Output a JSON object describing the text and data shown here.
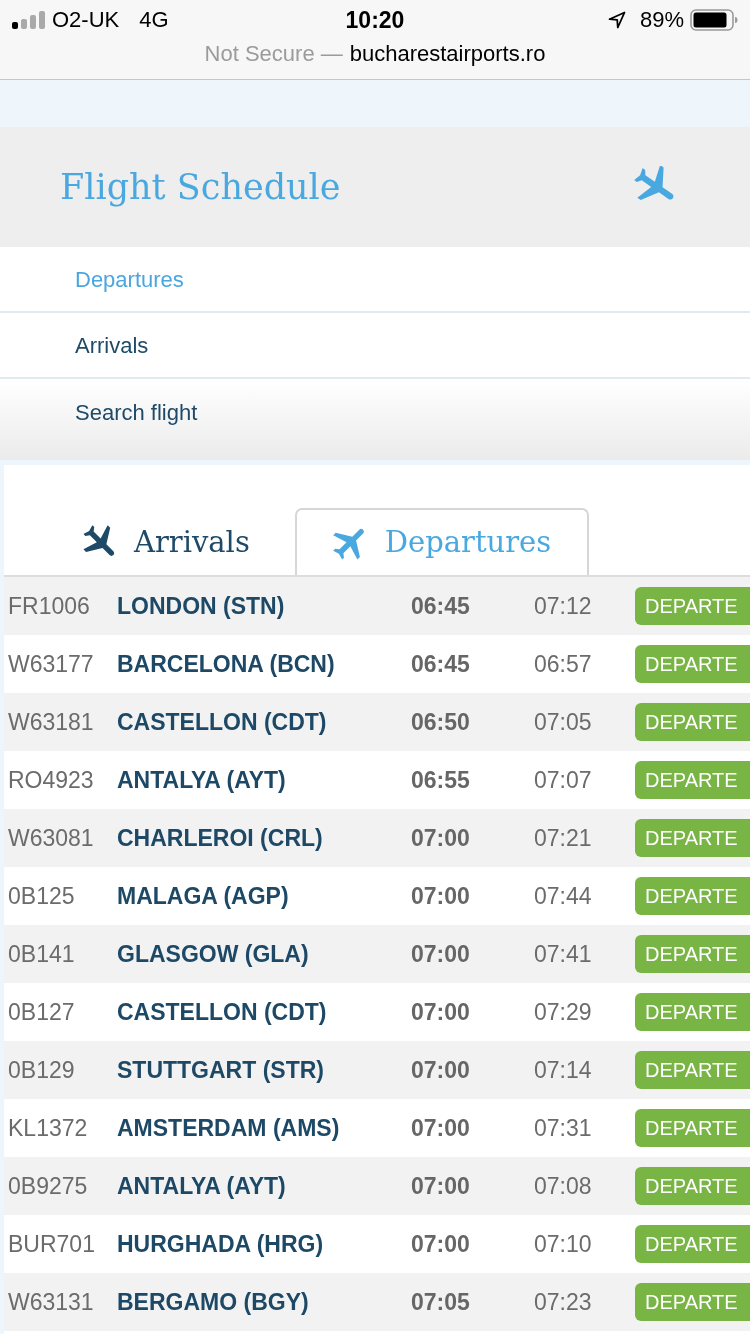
{
  "status_bar": {
    "carrier": "O2-UK",
    "network": "4G",
    "time": "10:20",
    "battery": "89%"
  },
  "address_bar": {
    "security": "Not Secure —",
    "domain": "bucharestairports.ro"
  },
  "header": {
    "title": "Flight Schedule"
  },
  "menu": [
    {
      "label": "Departures",
      "selected": true
    },
    {
      "label": "Arrivals",
      "selected": false
    },
    {
      "label": "Search flight",
      "selected": false
    }
  ],
  "tabs": [
    {
      "label": "Arrivals",
      "selected": false
    },
    {
      "label": "Departures",
      "selected": true
    }
  ],
  "flights": [
    {
      "flight": "FR1006",
      "destination": "LONDON (STN)",
      "scheduled": "06:45",
      "actual": "07:12",
      "status": "DEPARTE"
    },
    {
      "flight": "W63177",
      "destination": "BARCELONA (BCN)",
      "scheduled": "06:45",
      "actual": "06:57",
      "status": "DEPARTE"
    },
    {
      "flight": "W63181",
      "destination": "CASTELLON (CDT)",
      "scheduled": "06:50",
      "actual": "07:05",
      "status": "DEPARTE"
    },
    {
      "flight": "RO4923",
      "destination": "ANTALYA (AYT)",
      "scheduled": "06:55",
      "actual": "07:07",
      "status": "DEPARTE"
    },
    {
      "flight": "W63081",
      "destination": "CHARLEROI (CRL)",
      "scheduled": "07:00",
      "actual": "07:21",
      "status": "DEPARTE"
    },
    {
      "flight": "0B125",
      "destination": "MALAGA (AGP)",
      "scheduled": "07:00",
      "actual": "07:44",
      "status": "DEPARTE"
    },
    {
      "flight": "0B141",
      "destination": "GLASGOW (GLA)",
      "scheduled": "07:00",
      "actual": "07:41",
      "status": "DEPARTE"
    },
    {
      "flight": "0B127",
      "destination": "CASTELLON (CDT)",
      "scheduled": "07:00",
      "actual": "07:29",
      "status": "DEPARTE"
    },
    {
      "flight": "0B129",
      "destination": "STUTTGART (STR)",
      "scheduled": "07:00",
      "actual": "07:14",
      "status": "DEPARTE"
    },
    {
      "flight": "KL1372",
      "destination": "AMSTERDAM (AMS)",
      "scheduled": "07:00",
      "actual": "07:31",
      "status": "DEPARTE"
    },
    {
      "flight": "0B9275",
      "destination": "ANTALYA (AYT)",
      "scheduled": "07:00",
      "actual": "07:08",
      "status": "DEPARTE"
    },
    {
      "flight": "BUR701",
      "destination": "HURGHADA (HRG)",
      "scheduled": "07:00",
      "actual": "07:10",
      "status": "DEPARTE"
    },
    {
      "flight": "W63131",
      "destination": "BERGAMO (BGY)",
      "scheduled": "07:05",
      "actual": "07:23",
      "status": "DEPARTE"
    }
  ]
}
